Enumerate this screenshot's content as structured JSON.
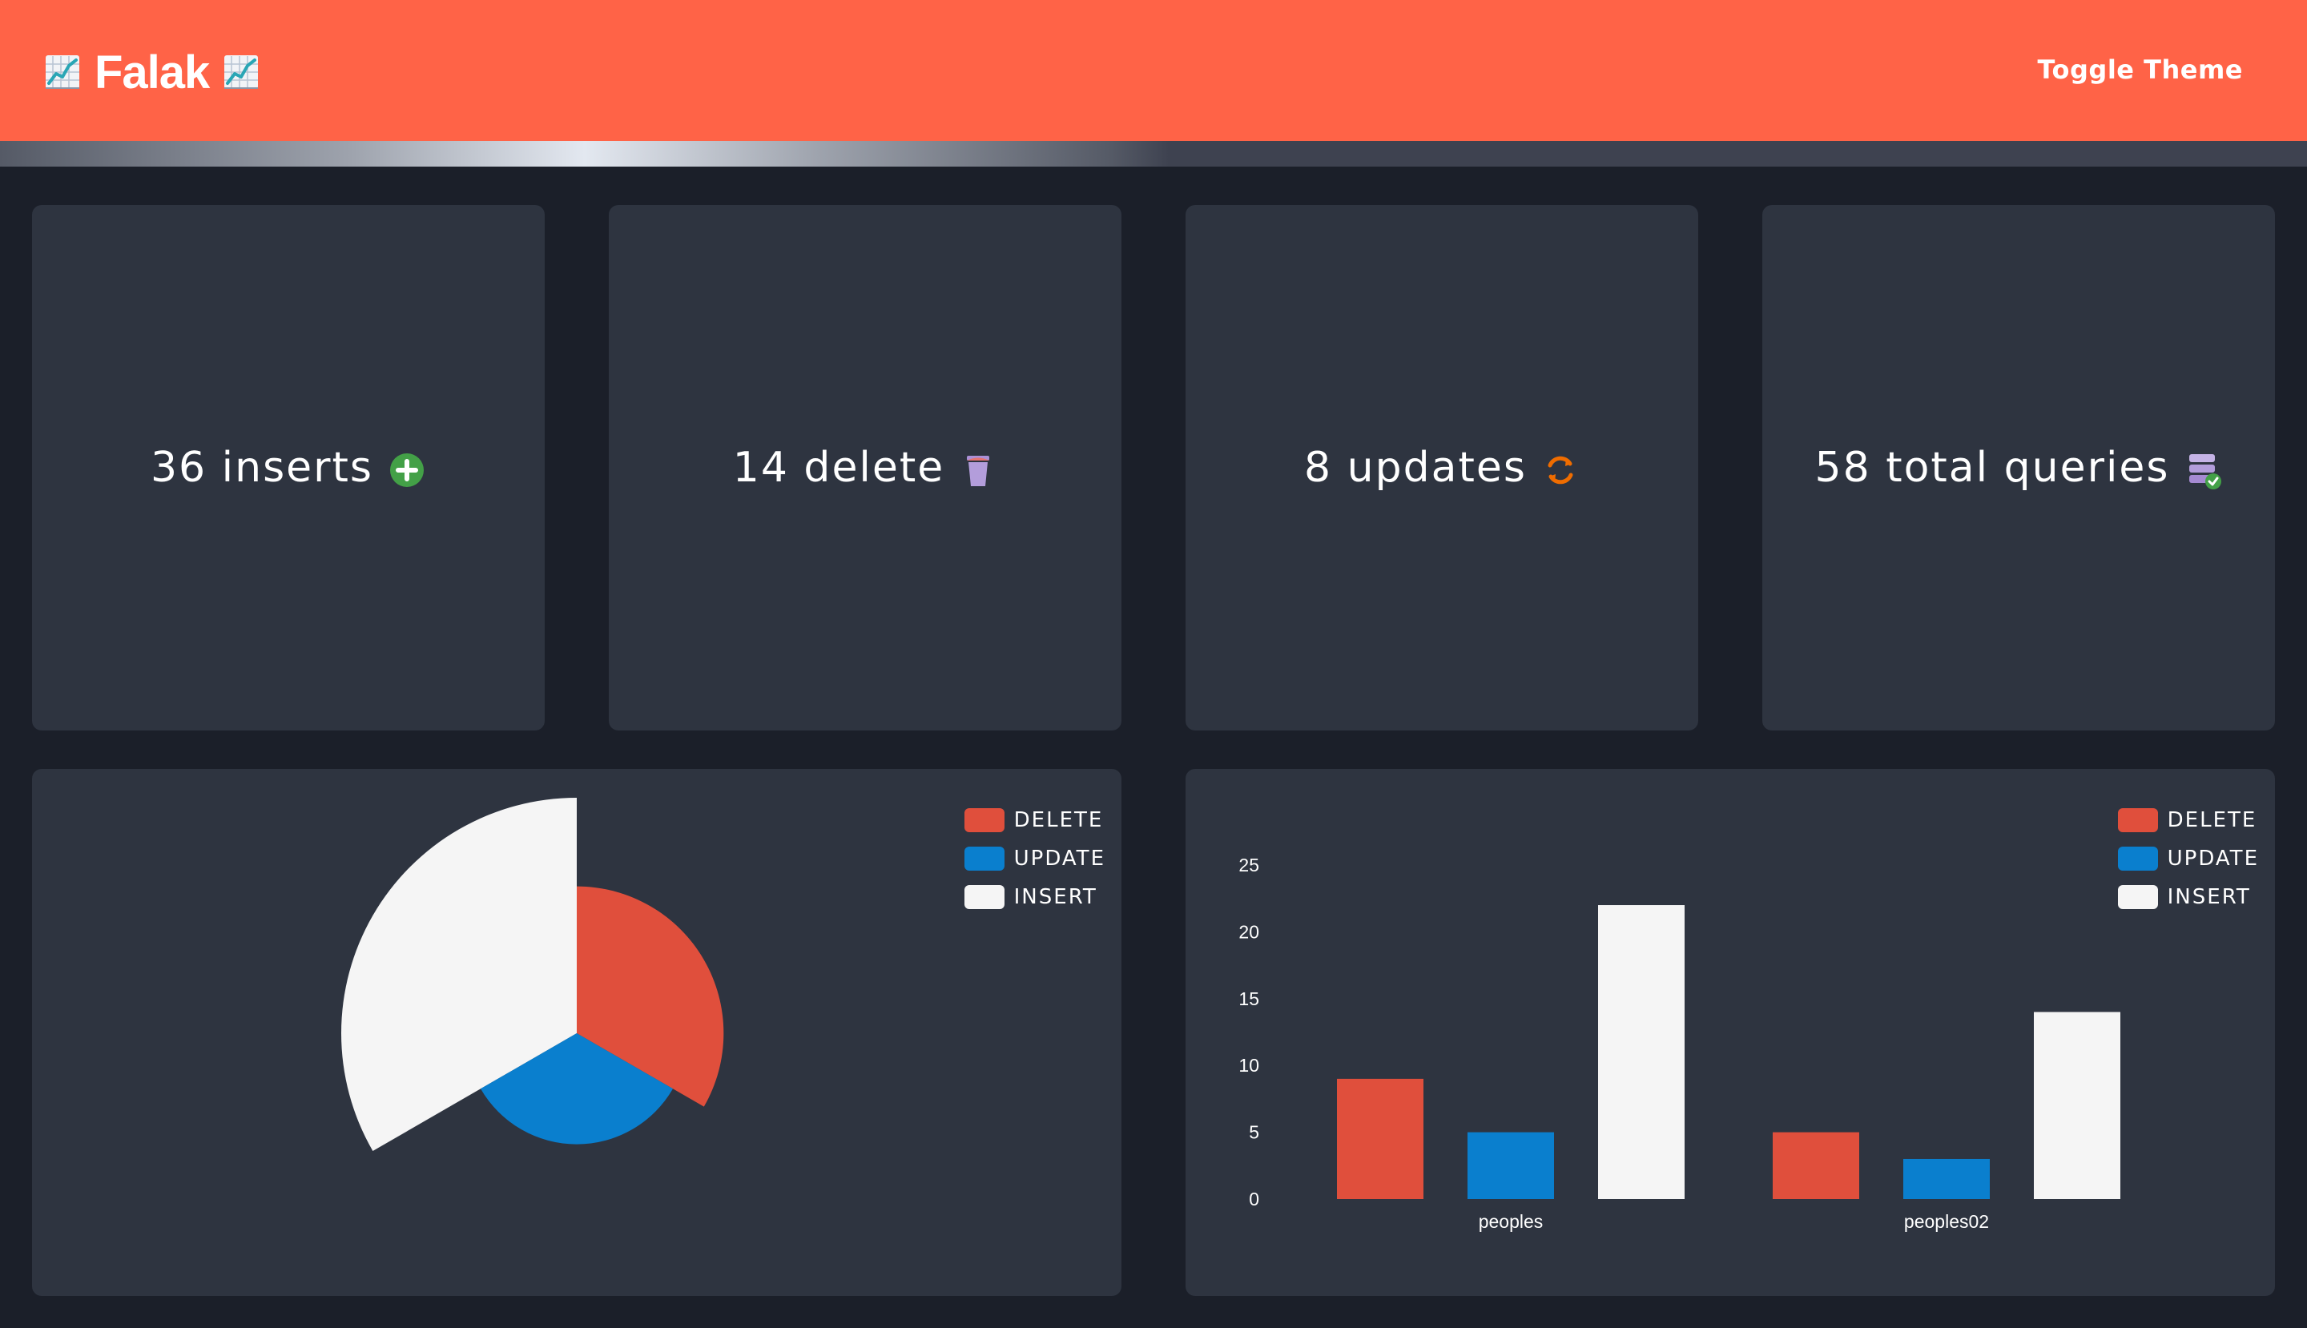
{
  "header": {
    "title": "Falak",
    "toggle_label": "Toggle Theme",
    "brand_color": "#ff6347",
    "title_icon": "chart-increasing-emoji"
  },
  "stats": [
    {
      "text": "36 inserts",
      "icon": "plus-circle-icon",
      "icon_color": "#43a047"
    },
    {
      "text": "14 delete",
      "icon": "trash-icon",
      "icon_color": "#b39ddb"
    },
    {
      "text": "8 updates",
      "icon": "refresh-icon",
      "icon_color": "#ef6c00"
    },
    {
      "text": "58 total queries",
      "icon": "database-check-icon",
      "icon_color": "#b39ddb"
    }
  ],
  "legend": [
    {
      "label": "DELETE",
      "color": "#e04f3c"
    },
    {
      "label": "UPDATE",
      "color": "#0a7fce"
    },
    {
      "label": "INSERT",
      "color": "#f5f5f5"
    }
  ],
  "chart_data": [
    {
      "type": "pie",
      "variant": "polar-area",
      "categories": [
        "DELETE",
        "UPDATE",
        "INSERT"
      ],
      "values": [
        14,
        8,
        36
      ],
      "colors": [
        "#e04f3c",
        "#0a7fce",
        "#f5f5f5"
      ],
      "legend_position": "top-right"
    },
    {
      "type": "bar",
      "categories": [
        "peoples",
        "peoples02"
      ],
      "series": [
        {
          "name": "DELETE",
          "values": [
            9,
            5
          ],
          "color": "#e04f3c"
        },
        {
          "name": "UPDATE",
          "values": [
            5,
            3
          ],
          "color": "#0a7fce"
        },
        {
          "name": "INSERT",
          "values": [
            22,
            14
          ],
          "color": "#f5f5f5"
        }
      ],
      "yticks": [
        0,
        5,
        10,
        15,
        20,
        25
      ],
      "ylim": [
        0,
        25
      ],
      "grid": false,
      "legend_position": "top-right"
    }
  ]
}
